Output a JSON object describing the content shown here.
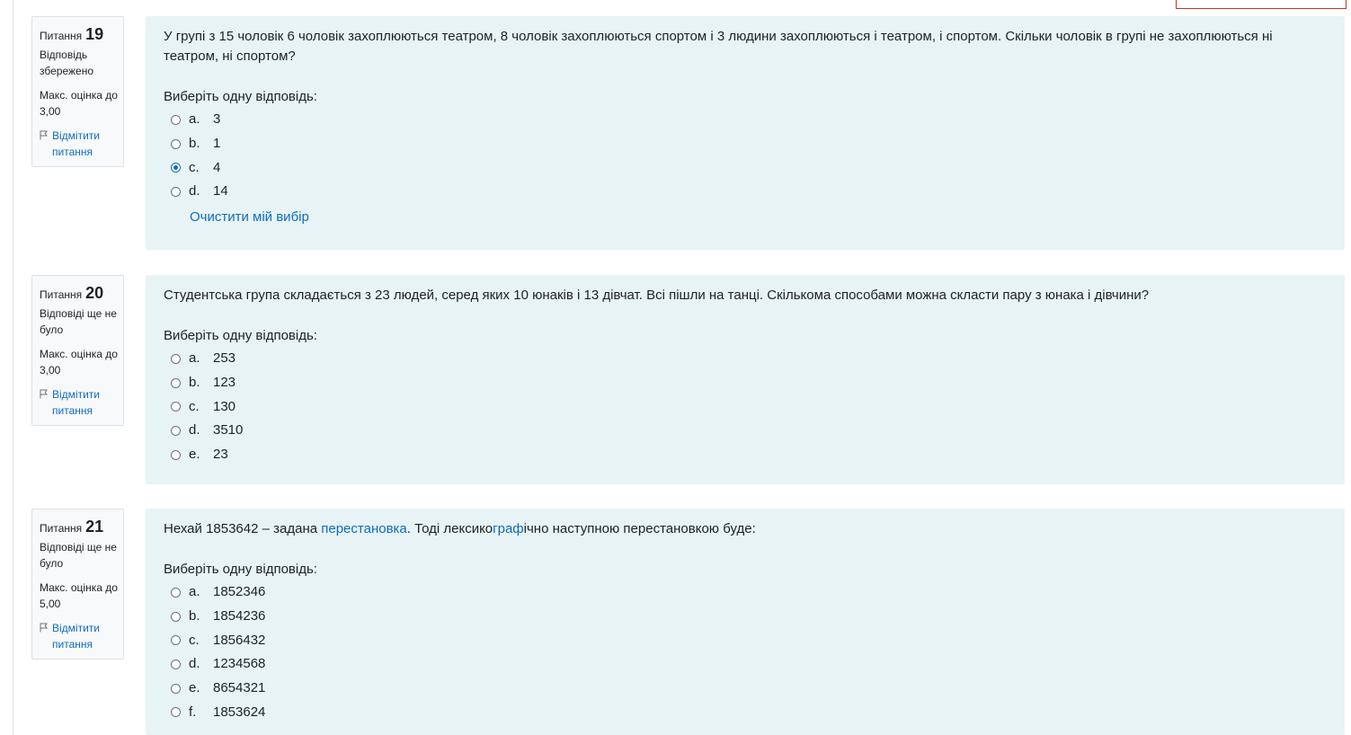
{
  "questions": [
    {
      "label": "Питання",
      "number": "19",
      "state": "Відповідь збережено",
      "grade": "Макс. оцінка до 3,00",
      "flag": "Відмітити питання",
      "text": "У групі з 15 чоловік 6 чоловік захоплюються театром, 8 чоловік захоплюються спортом і 3 людини захоплюються і театром, і спортом. Скільки чоловік в групі не захоплюються ні театром, ні спортом?",
      "prompt": "Виберіть одну відповідь:",
      "options": [
        {
          "letter": "a.",
          "value": "3",
          "checked": false
        },
        {
          "letter": "b.",
          "value": "1",
          "checked": false
        },
        {
          "letter": "c.",
          "value": "4",
          "checked": true
        },
        {
          "letter": "d.",
          "value": "14",
          "checked": false
        }
      ],
      "clear": "Очистити мій вибір"
    },
    {
      "label": "Питання",
      "number": "20",
      "state": "Відповіді ще не було",
      "grade": "Макс. оцінка до 3,00",
      "flag": "Відмітити питання",
      "text": "Студентська група складається з 23 людей, серед яких 10 юнаків і 13 дівчат. Всі пішли на танці. Скількома способами можна скласти пару з юнака і дівчини?",
      "prompt": "Виберіть одну відповідь:",
      "options": [
        {
          "letter": "a.",
          "value": "253",
          "checked": false
        },
        {
          "letter": "b.",
          "value": "123",
          "checked": false
        },
        {
          "letter": "c.",
          "value": "130",
          "checked": false
        },
        {
          "letter": "d.",
          "value": "3510",
          "checked": false
        },
        {
          "letter": "e.",
          "value": "23",
          "checked": false
        }
      ]
    },
    {
      "label": "Питання",
      "number": "21",
      "state": "Відповіді ще не було",
      "grade": "Макс. оцінка до 5,00",
      "flag": "Відмітити питання",
      "text_before": "Нехай 1853642 – задана ",
      "link1": "перестановка",
      "text_mid": ". Тоді лексико",
      "link2": "граф",
      "text_after": "ічно наступною перестановкою буде:",
      "prompt": "Виберіть одну відповідь:",
      "options": [
        {
          "letter": "a.",
          "value": "1852346",
          "checked": false
        },
        {
          "letter": "b.",
          "value": "1854236",
          "checked": false
        },
        {
          "letter": "c.",
          "value": "1856432",
          "checked": false
        },
        {
          "letter": "d.",
          "value": "1234568",
          "checked": false
        },
        {
          "letter": "e.",
          "value": "8654321",
          "checked": false
        },
        {
          "letter": "f.",
          "value": "1853624",
          "checked": false
        }
      ]
    }
  ]
}
